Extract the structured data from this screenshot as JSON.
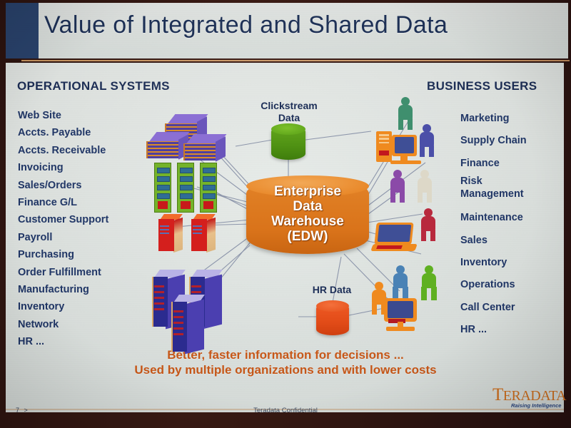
{
  "slide": {
    "title": "Value of Integrated and Shared Data",
    "tagline_line1": "Better, faster information for decisions ...",
    "tagline_line2": "Used by multiple organizations and with lower costs"
  },
  "left_column": {
    "heading": "OPERATIONAL SYSTEMS",
    "items": [
      "Web Site",
      "Accts. Payable",
      "Accts. Receivable",
      "Invoicing",
      "Sales/Orders",
      "Finance G/L",
      "Customer Support",
      "Payroll",
      "Purchasing",
      "Order Fulfillment",
      "Manufacturing",
      "Inventory",
      "Network",
      "HR ..."
    ]
  },
  "right_column": {
    "heading": "BUSINESS USERS",
    "items": [
      "Marketing",
      "Supply Chain",
      "Finance",
      "Risk",
      "Management",
      "Maintenance",
      "Sales",
      "Inventory",
      "Operations",
      "Call Center",
      "HR ..."
    ]
  },
  "center": {
    "edw_line1": "Enterprise",
    "edw_line2": "Data",
    "edw_line3": "Warehouse",
    "edw_line4": "(EDW)",
    "clickstream_line1": "Clickstream",
    "clickstream_line2": "Data",
    "hr_data": "HR Data"
  },
  "footer": {
    "page": "7  >",
    "confidential": "Teradata Confidential",
    "logo_lead": "T",
    "logo_rest": "ERADATA",
    "logo_tagline": "Raising Intelligence"
  },
  "colors": {
    "title_navy": "#2b4570",
    "title_text": "#1e3259",
    "list_text": "#21386a",
    "edw_orange": "#e07f24",
    "clickstream_green": "#4f9113",
    "hr_red": "#e24c18",
    "tagline_orange": "#cf5a18",
    "logo_orange": "#d9741f",
    "rule_tan": "#cf9a63"
  }
}
